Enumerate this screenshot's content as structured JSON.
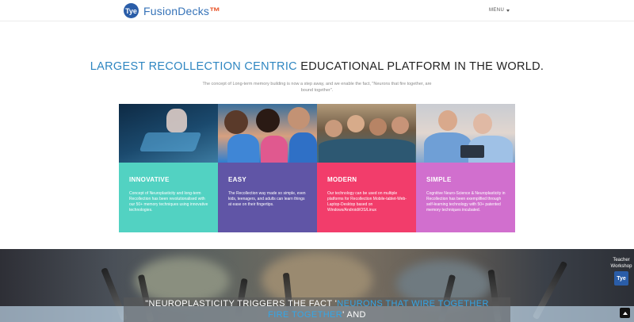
{
  "header": {
    "logo_mark": "Tye",
    "brand": "FusionDecks",
    "trademark": "™",
    "menu_label": "MENU"
  },
  "hero": {
    "headline_accent": "LARGEST RECOLLECTION CENTRIC",
    "headline_rest": " EDUCATIONAL PLATFORM IN THE WORLD.",
    "subtext": "The concept of Long-term memory building is now a step away, and we enable the fact, \"Neurons that fire together, are bound together\"."
  },
  "cards": [
    {
      "title": "INNOVATIVE",
      "text": "Concept of Neuroplasticity and long-term Recollection has been revolutionalised with our 50+ memory techniques using innovative technologies.",
      "color": "#52d2c2"
    },
    {
      "title": "EASY",
      "text": "The Recollection way made so simple, even kids, teenagers, and adults can learn things at ease on their fingertips.",
      "color": "#6055a6"
    },
    {
      "title": "MODERN",
      "text": "Our technology can be used on multiple platforms for Recollection Mobile-tablet-Web-Laptop-Desktop based on Windows/Android/iOS/Linux",
      "color": "#f23d6b"
    },
    {
      "title": "SIMPLE",
      "text": "Cognitive Neuro-Science & Neuroplasticity in Recollection has been exemplified through self-learning technology with 50+ patented memory techniques incubated.",
      "color": "#d16fce"
    }
  ],
  "banner": {
    "quote_start": "\"NEUROPLASTICITY TRIGGERS THE FACT '",
    "quote_highlight": "NEURONS THAT WIRE TOGETHER",
    "quote_highlight2": "FIRE TOGETHER",
    "quote_end": "' AND",
    "workshop_label": "Teacher Workshop",
    "workshop_icon": "Tye"
  }
}
